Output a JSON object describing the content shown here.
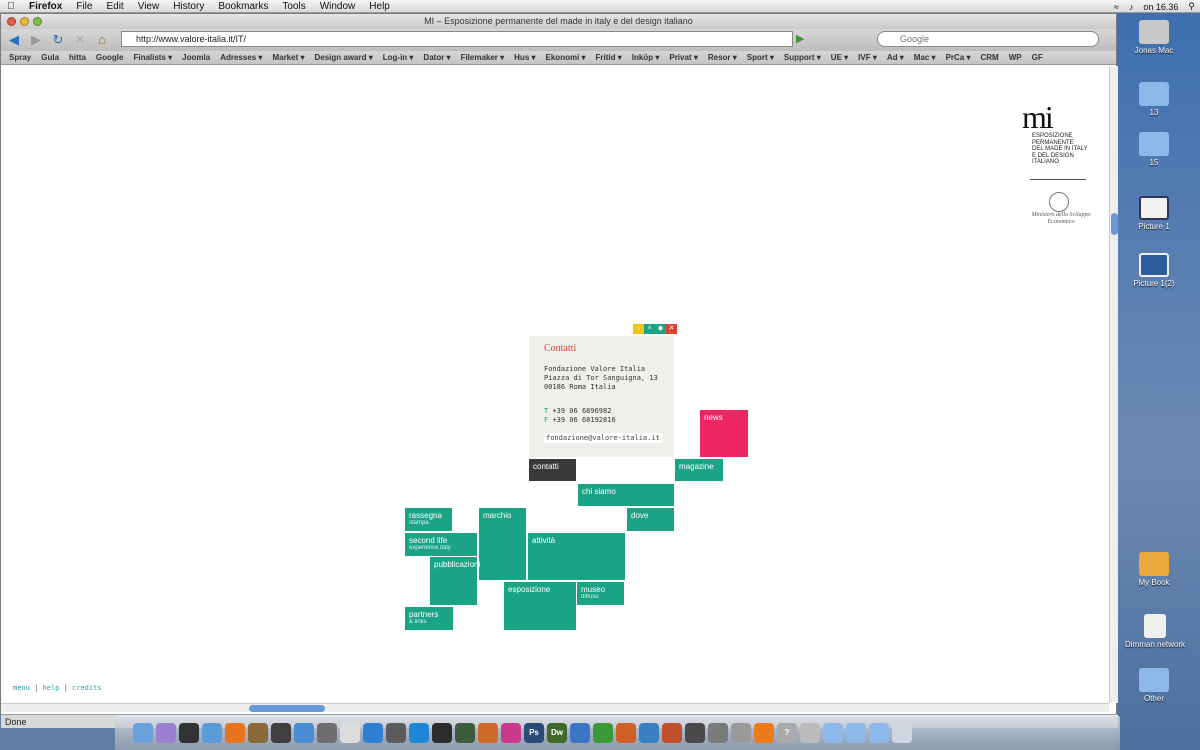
{
  "menubar": {
    "app": "Firefox",
    "items": [
      "File",
      "Edit",
      "View",
      "History",
      "Bookmarks",
      "Tools",
      "Window",
      "Help"
    ],
    "clock": "on 16.36"
  },
  "window": {
    "title": "MI – Esposizione permanente del made in italy e del design italiano",
    "url": "http://www.valore-italia.it/IT/",
    "search_placeholder": "Google",
    "status": "Done"
  },
  "bookmarks": [
    "Spray",
    "Gula",
    "hitta",
    "Google",
    "Finalists ▾",
    "Joomla",
    "Adresses ▾",
    "Market ▾",
    "Design award ▾",
    "Log-in ▾",
    "Dator ▾",
    "Filemaker ▾",
    "Hus ▾",
    "Ekonomi ▾",
    "Fritid ▾",
    "Inköp ▾",
    "Privat ▾",
    "Resor ▾",
    "Sport ▾",
    "Support ▾",
    "UE ▾",
    "IVF ▾",
    "Ad ▾",
    "Mac ▾",
    "PrCa ▾",
    "CRM",
    "WP",
    "GF"
  ],
  "logo": {
    "mark": "mi",
    "lines": [
      "ESPOSIZIONE",
      "PERMANENTE",
      "DEL MADE IN ITALY",
      "E DEL DESIGN",
      "ITALIANO"
    ],
    "ministry": "Ministero dello Sviluppo Economico"
  },
  "contact": {
    "title": "Contatti",
    "address": "Fondazione Valore Italia\nPiazza di Tor Sanguigna, 13\n00186 Roma Italia",
    "phone_label": "T",
    "phone": "+39 06 6896982",
    "fax_label": "F",
    "fax": "+39 06 68192816",
    "email": "fondazione@valore-italia.it"
  },
  "tiles": {
    "contatti": "contatti",
    "news": "news",
    "magazine": "magazine",
    "chi_siamo": "chi siamo",
    "dove": "dove",
    "rassegna": "rassegna",
    "rassegna_sub": "stampa",
    "second_life": "second life",
    "second_life_sub": "experience italy",
    "marchio": "marchio",
    "attivita": "attività",
    "pubblicazioni": "pubblicazioni",
    "esposizione": "esposizione",
    "museo": "museo",
    "museo_sub": "diffuso",
    "partners": "partners",
    "partners_sub": "& links"
  },
  "footer": {
    "menu": "menu",
    "help": "help",
    "credits": "credits",
    "sep": " | "
  },
  "desktop": [
    "Jonas Mac",
    "13",
    "15",
    "Picture 1",
    "Picture 1(2)",
    "My Book",
    "Dimman network",
    "Other"
  ],
  "colors": {
    "tile": "#1aa385",
    "news": "#ed2563",
    "contatti_tile": "#3a3a3a",
    "title_red": "#e0412d"
  }
}
